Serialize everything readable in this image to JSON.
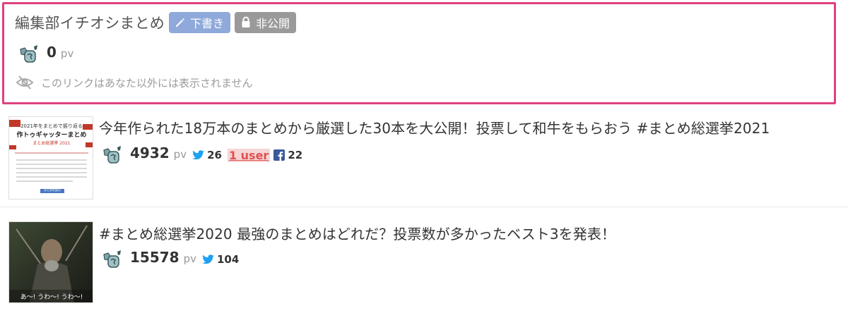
{
  "draft": {
    "title": "編集部イチオシまとめ",
    "badge_draft": "下書き",
    "badge_private": "非公開",
    "pv_count": "0",
    "pv_unit": "pv",
    "notice": "このリンクはあなた以外には表示されません"
  },
  "articles": [
    {
      "title": "今年作られた18万本のまとめから厳選した30本を大公開！投票して和牛をもらおう #まとめ総選挙2021",
      "pv_count": "4932",
      "pv_unit": "pv",
      "twitter_count": "26",
      "user_link": "1 user",
      "facebook_count": "22",
      "thumb": {
        "line1": "2021年をまとめで振り返る",
        "line2": "作トゥギャッターまとめ",
        "line3": "まとめ総選挙 2021",
        "button": "まとめを読む"
      }
    },
    {
      "title": "#まとめ総選挙2020 最強のまとめはどれだ？投票数が多かったベスト3を発表！",
      "pv_count": "15578",
      "pv_unit": "pv",
      "twitter_count": "104",
      "thumb": {
        "caption": "あ～! うわ～! うわ～!"
      }
    }
  ],
  "colors": {
    "highlight_border": "#e0407f",
    "badge_draft": "#8fa9da",
    "badge_private": "#9a9a9a",
    "twitter": "#1da1f2",
    "facebook": "#3b5998",
    "user_link": "#e05050"
  },
  "icons": [
    "pencil-icon",
    "lock-icon",
    "pv-mascot-icon",
    "eye-slash-icon",
    "twitter-icon",
    "facebook-icon"
  ]
}
